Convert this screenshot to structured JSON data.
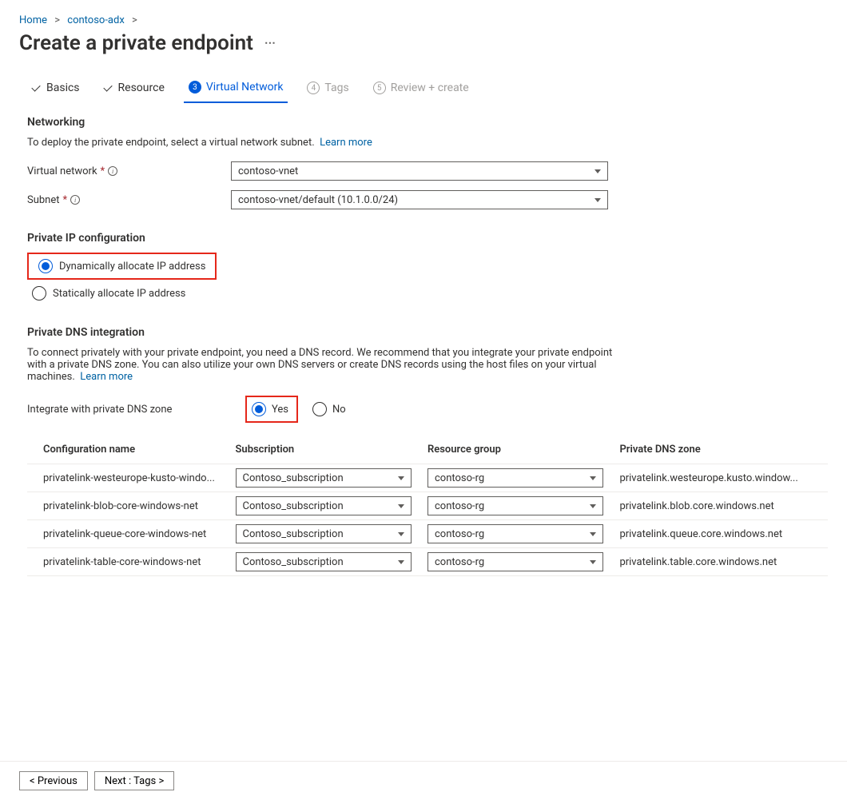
{
  "breadcrumb": {
    "home": "Home",
    "resource": "contoso-adx"
  },
  "page_title": "Create a private endpoint",
  "tabs": {
    "basics": "Basics",
    "resource": "Resource",
    "vnet_num": "3",
    "vnet": "Virtual Network",
    "tags_num": "4",
    "tags": "Tags",
    "review_num": "5",
    "review": "Review + create"
  },
  "networking": {
    "heading": "Networking",
    "desc": "To deploy the private endpoint, select a virtual network subnet.",
    "learn_more": "Learn more",
    "vnet_label": "Virtual network",
    "vnet_value": "contoso-vnet",
    "subnet_label": "Subnet",
    "subnet_value": "contoso-vnet/default (10.1.0.0/24)"
  },
  "ipconfig": {
    "heading": "Private IP configuration",
    "dynamic": "Dynamically allocate IP address",
    "static": "Statically allocate IP address"
  },
  "dns": {
    "heading": "Private DNS integration",
    "desc": "To connect privately with your private endpoint, you need a DNS record. We recommend that you integrate your private endpoint with a private DNS zone. You can also utilize your own DNS servers or create DNS records using the host files on your virtual machines.",
    "learn_more": "Learn more",
    "integrate_label": "Integrate with private DNS zone",
    "yes": "Yes",
    "no": "No",
    "table": {
      "headers": {
        "config": "Configuration name",
        "sub": "Subscription",
        "rg": "Resource group",
        "zone": "Private DNS zone"
      },
      "rows": [
        {
          "name": "privatelink-westeurope-kusto-windo...",
          "sub": "Contoso_subscription",
          "rg": "contoso-rg",
          "zone": "privatelink.westeurope.kusto.window..."
        },
        {
          "name": "privatelink-blob-core-windows-net",
          "sub": "Contoso_subscription",
          "rg": "contoso-rg",
          "zone": "privatelink.blob.core.windows.net"
        },
        {
          "name": "privatelink-queue-core-windows-net",
          "sub": "Contoso_subscription",
          "rg": "contoso-rg",
          "zone": "privatelink.queue.core.windows.net"
        },
        {
          "name": "privatelink-table-core-windows-net",
          "sub": "Contoso_subscription",
          "rg": "contoso-rg",
          "zone": "privatelink.table.core.windows.net"
        }
      ]
    }
  },
  "footer": {
    "previous": "< Previous",
    "next": "Next : Tags >"
  }
}
